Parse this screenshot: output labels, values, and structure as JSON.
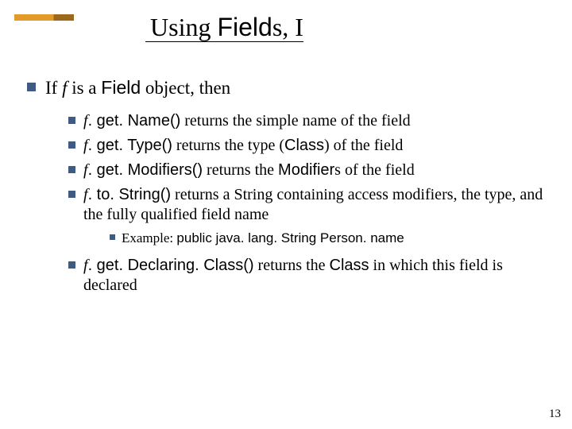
{
  "title_plain": "Using ",
  "title_mono": "Field",
  "title_suffix": "s, I",
  "l1_a": "If ",
  "l1_b": "f",
  "l1_c": " is a ",
  "l1_d": "Field",
  "l1_e": " object, then",
  "m1_a": "f",
  "m1_b": ". get. Name()",
  "m1_c": " returns the simple name of the field",
  "m2_a": "f",
  "m2_b": ". get. Type()",
  "m2_c": " returns the type (",
  "m2_d": "Class",
  "m2_e": ") of the field",
  "m3_a": "f",
  "m3_b": ". get. Modifiers()",
  "m3_c": " returns the ",
  "m3_d": "Modifier",
  "m3_e": "s of the field",
  "m4_a": "f",
  "m4_b": ". to. String()",
  "m4_c": " returns a String containing access modifiers, the type, and the fully qualified field name",
  "ex_a": "Example: ",
  "ex_b": "public  java. lang. String  Person. name",
  "m5_a": "f",
  "m5_b": ". get. Declaring. Class()",
  "m5_c": " returns the ",
  "m5_d": "Class",
  "m5_e": " in which this field is declared",
  "page": "13"
}
